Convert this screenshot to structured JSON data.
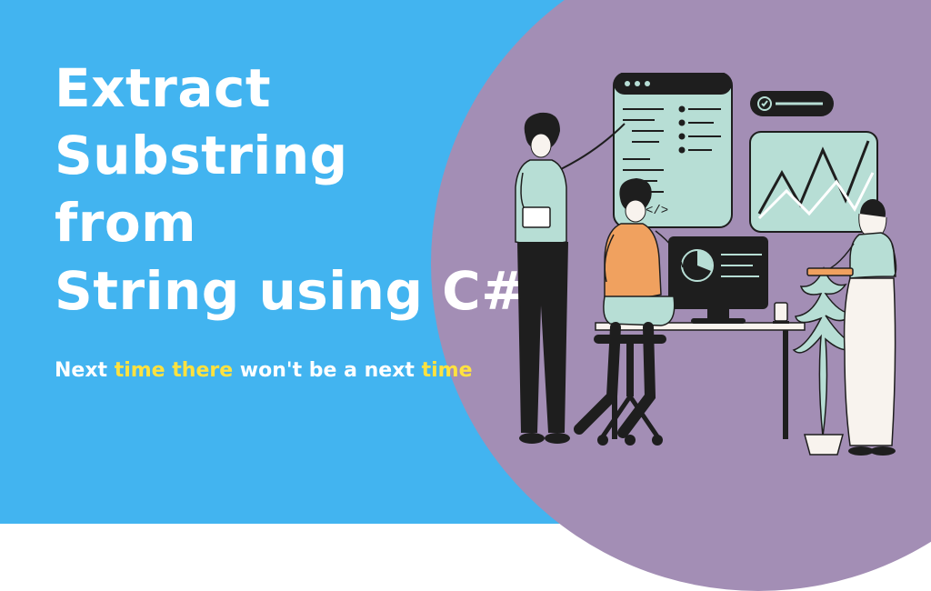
{
  "heading": {
    "line1": "Extract",
    "line2": "Substring",
    "line3": "from",
    "line4": "String using C#"
  },
  "subhead": {
    "parts": [
      {
        "text": "Next ",
        "hl": false
      },
      {
        "text": "time ",
        "hl": true
      },
      {
        "text": "there ",
        "hl": true
      },
      {
        "text": "won't be a next ",
        "hl": false
      },
      {
        "text": "time",
        "hl": true
      }
    ]
  },
  "colors": {
    "bg_left": "#42b4f0",
    "bg_circle": "#a38eb5",
    "accent": "#b7ded5",
    "dark": "#1e1e1e",
    "highlight": "#ffe23f"
  }
}
